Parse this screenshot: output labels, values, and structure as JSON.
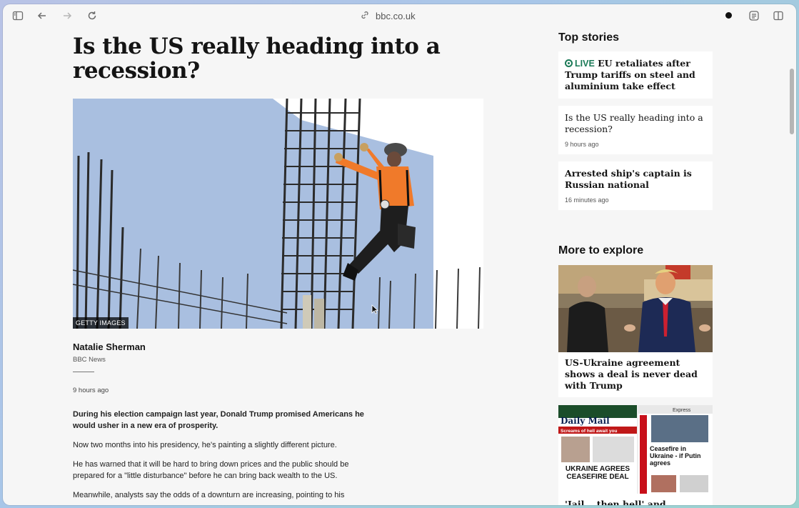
{
  "browser": {
    "url": "bbc.co.uk",
    "icons": [
      "sidebar-icon",
      "back-icon",
      "forward-icon",
      "reload-icon",
      "link-icon",
      "record-icon",
      "reader-icon",
      "split-view-icon"
    ]
  },
  "article": {
    "headline": "Is the US really heading into a recession?",
    "image_credit": "GETTY IMAGES",
    "author": "Natalie Sherman",
    "organization": "BBC News",
    "timestamp": "9 hours ago",
    "paragraphs": [
      "During his election campaign last year, Donald Trump promised Americans he would usher in a new era of prosperity.",
      "Now two months into his presidency, he's painting a slightly different picture.",
      "He has warned that it will be hard to bring down prices and the public should be prepared for a \"little disturbance\" before he can bring back wealth to the US.",
      "Meanwhile, analysts say the odds of a downturn are increasing, pointing to his"
    ]
  },
  "sidebar": {
    "top_stories_title": "Top stories",
    "stories": [
      {
        "live_label": "LIVE",
        "title": "EU retaliates after Trump tariffs on steel and aluminium take effect"
      },
      {
        "title": "Is the US really heading into a recession?",
        "meta": "9 hours ago"
      },
      {
        "title": "Arrested ship's captain is Russian national",
        "meta": "16 minutes ago"
      }
    ],
    "more_title": "More to explore",
    "explore": [
      {
        "caption": "US-Ukraine agreement shows a deal is never dead with Trump"
      },
      {
        "caption": "'Jail... then hell' and ceasefire"
      }
    ],
    "papers_text": {
      "mail_masthead": "Daily Mail",
      "mail_kicker": "Screams of hell await you",
      "mail_headline": "UKRAINE AGREES CEASEFIRE DEAL",
      "express_masthead": "Express",
      "express_headline": "Ceasefire in Ukraine - if Putin agrees"
    }
  },
  "colors": {
    "live_green": "#1b7a57",
    "sky": "#a9bfe0",
    "vest": "#f07a2a"
  }
}
